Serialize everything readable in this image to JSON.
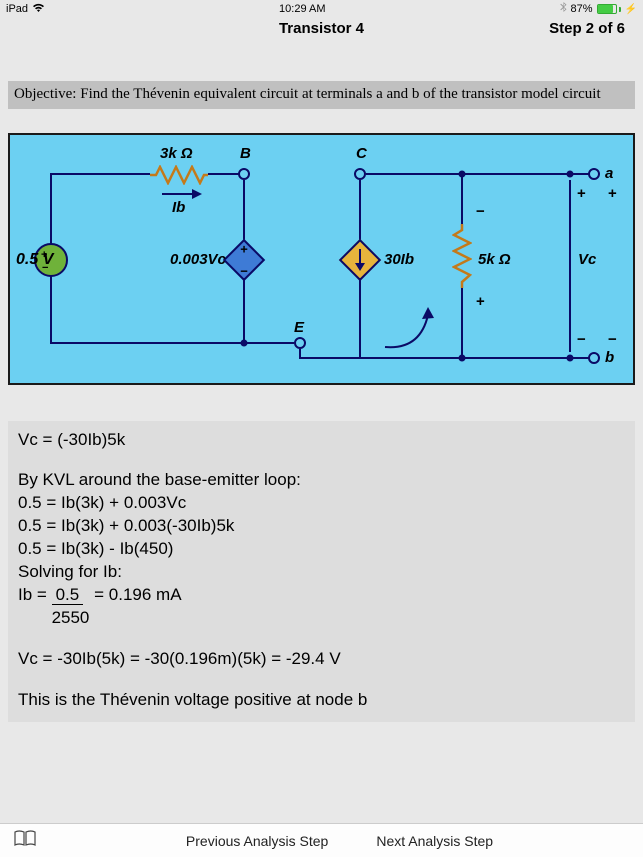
{
  "status": {
    "device": "iPad",
    "time": "10:29 AM",
    "battery_pct": "87%"
  },
  "header": {
    "title": "Transistor 4",
    "step_label": "Step  2 of  6"
  },
  "objective": "Objective: Find the Thévenin equivalent circuit at terminals a and b of the transistor model circuit",
  "circuit": {
    "r1_label": "3k Ω",
    "r2_label": "5k Ω",
    "ib_label": "Ib",
    "nodeB": "B",
    "nodeC": "C",
    "nodeE": "E",
    "termA": "a",
    "termB": "b",
    "vsrc": "0.5 V",
    "dep_v": "0.003Vc",
    "dep_i": "30Ib",
    "vc_label": "Vc",
    "plus": "+",
    "minus": "−"
  },
  "calc": {
    "l1": "Vc = (-30Ib)5k",
    "l2": "By KVL around the base-emitter loop:",
    "l3": "0.5 = Ib(3k) + 0.003Vc",
    "l4": "0.5 = Ib(3k) + 0.003(-30Ib)5k",
    "l5": "0.5 = Ib(3k) - Ib(450)",
    "l6": "Solving for Ib:",
    "l7a": "Ib = ",
    "l7num": " 0.5 ",
    "l7den": "2550",
    "l7b": " = 0.196 mA",
    "l8": "Vc = -30Ib(5k) = -30(0.196m)(5k) = -29.4 V",
    "l9": "This is the Thévenin voltage positive at node b"
  },
  "bottom": {
    "prev": "Previous Analysis Step",
    "next": "Next Analysis Step"
  }
}
